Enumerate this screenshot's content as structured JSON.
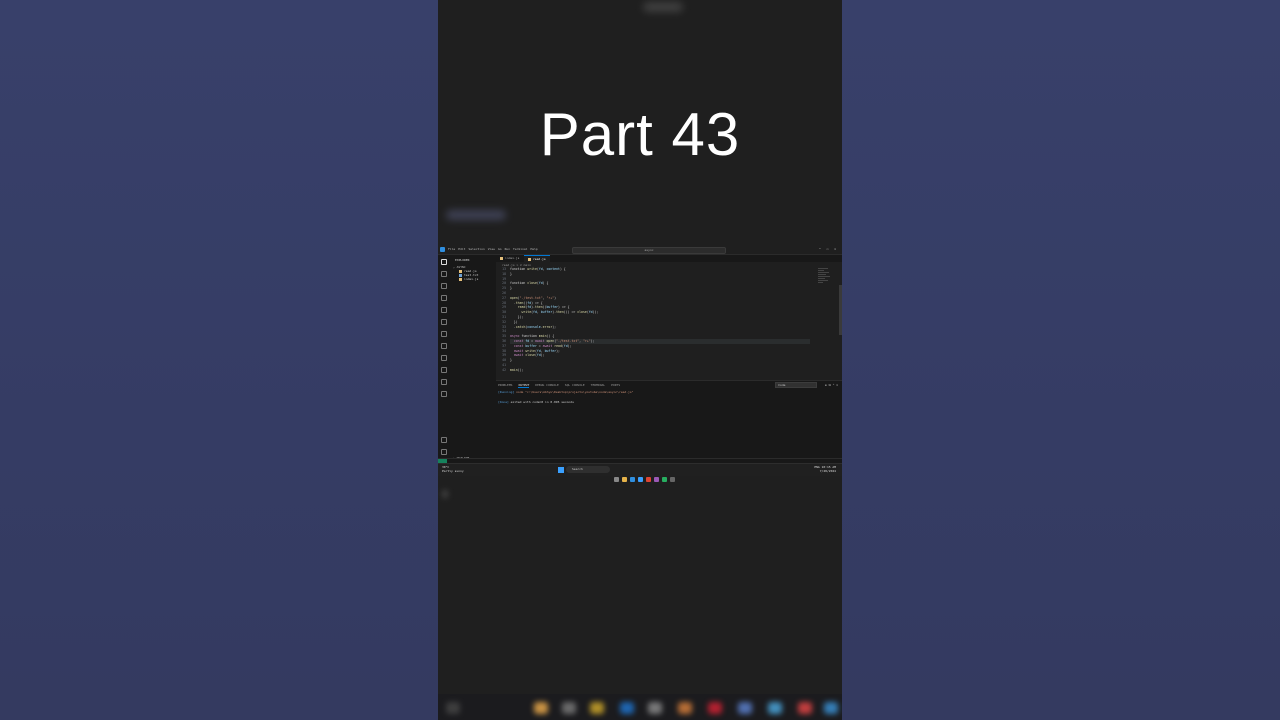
{
  "overlay": {
    "title": "Part 43"
  },
  "vscode": {
    "menu": [
      "File",
      "Edit",
      "Selection",
      "View",
      "Go",
      "Run",
      "Terminal",
      "Help"
    ],
    "search_placeholder": "async",
    "explorer": {
      "header": "EXPLORER",
      "folder": "ASYNC",
      "files": [
        {
          "name": "read.js",
          "icon_color": "#e5c07b"
        },
        {
          "name": "test.txt",
          "icon_color": "#6fa3d8"
        },
        {
          "name": "index.js",
          "icon_color": "#e5c07b"
        }
      ],
      "outline": "OUTLINE",
      "timeline": "TIMELINE"
    },
    "tabs": [
      "index.js",
      "read.js"
    ],
    "breadcrumb": "read.js > ⊘ main",
    "code_lines": [
      {
        "n": "13",
        "html": "function <span class='fn'>write</span>(<span class='var'>fd</span>, <span class='var'>content</span>) {"
      },
      {
        "n": "18",
        "html": "}"
      },
      {
        "n": "19",
        "html": ""
      },
      {
        "n": "20",
        "html": "function <span class='fn'>close</span>(<span class='var'>fd</span>) {"
      },
      {
        "n": "25",
        "html": "}"
      },
      {
        "n": "26",
        "html": ""
      },
      {
        "n": "27",
        "html": "<span class='fn'>open</span>(<span class='str'>\"./test.txt\"</span>, <span class='str'>\"r+\"</span>)"
      },
      {
        "n": "28",
        "html": "  .<span class='fn'>then</span>((<span class='var'>fd</span>) => {"
      },
      {
        "n": "29",
        "html": "    <span class='fn'>read</span>(<span class='var'>fd</span>).<span class='fn'>then</span>((<span class='var'>buffer</span>) => {"
      },
      {
        "n": "30",
        "html": "      <span class='fn'>write</span>(<span class='var'>fd</span>, <span class='var'>buffer</span>).<span class='fn'>then</span>(() => <span class='fn'>close</span>(<span class='var'>fd</span>));"
      },
      {
        "n": "31",
        "html": "    });"
      },
      {
        "n": "32",
        "html": "  })"
      },
      {
        "n": "33",
        "html": "  .<span class='fn'>catch</span>(<span class='var'>console</span>.<span class='fn'>error</span>);"
      },
      {
        "n": "34",
        "html": ""
      },
      {
        "n": "35",
        "html": "<span class='kw'>async</span> function <span class='fn'>main</span>() {"
      },
      {
        "n": "36",
        "html": "  <span class='kw'>const</span> <span class='var'>fd</span> = <span class='kw'>await</span> <span class='fn'>open</span>(<span class='str'>\"./test.txt\"</span>, <span class='str'>\"r+\"</span>);"
      },
      {
        "n": "37",
        "html": "  <span class='kw'>const</span> <span class='var'>buffer</span> = <span class='kw'>await</span> <span class='fn'>read</span>(<span class='var'>fd</span>);"
      },
      {
        "n": "38",
        "html": "  <span class='kw'>await</span> <span class='fn'>write</span>(<span class='var'>fd</span>, <span class='var'>buffer</span>);"
      },
      {
        "n": "39",
        "html": "  <span class='kw'>await</span> <span class='fn'>close</span>(<span class='var'>fd</span>);"
      },
      {
        "n": "40",
        "html": "}"
      },
      {
        "n": "41",
        "html": ""
      },
      {
        "n": "42",
        "html": "<span class='fn'>main</span>();"
      }
    ],
    "panel": {
      "tabs": [
        "PROBLEMS",
        "OUTPUT",
        "DEBUG CONSOLE",
        "SQL CONSOLE",
        "TERMINAL",
        "PORTS"
      ],
      "active_tab": "OUTPUT",
      "channel": "Code",
      "running_tag": "[Running]",
      "running_cmd": "node \"c:\\Users\\Abhyu\\Desktop\\projects\\youtube\\node\\async\\read.js\"",
      "done_tag": "[Done]",
      "done_msg": "exited with code=0 in 0.095 seconds"
    },
    "taskbar": {
      "weather_temp": "30°C",
      "weather_desc": "Partly sunny",
      "search_label": "Search",
      "time": "10:15 AM",
      "date": "7/28/2024",
      "lang": "ENG"
    }
  }
}
